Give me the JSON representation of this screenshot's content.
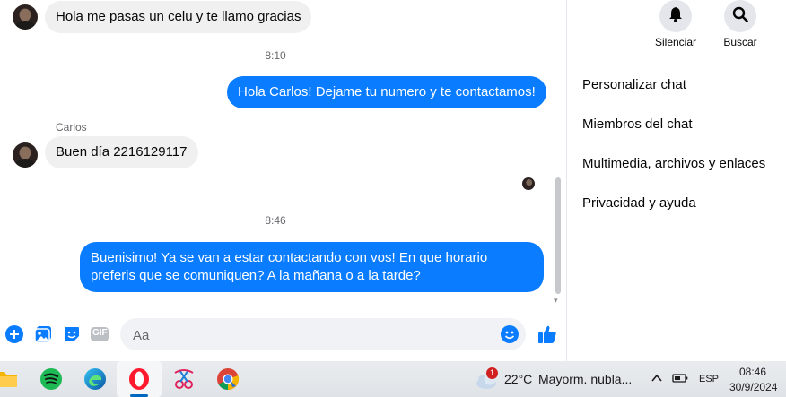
{
  "messages": {
    "in_1": "Hola me pasas un celu y te llamo gracias",
    "time_1": "8:10",
    "out_1": "Hola Carlos! Dejame tu numero y te contactamos!",
    "sender_name": "Carlos",
    "in_2": "Buen día 2216129117",
    "time_2": "8:46",
    "out_2": "Buenisimo! Ya se van a estar contactando con vos! En que horario preferis que se comuniquen? A la mañana o a la tarde?"
  },
  "composer": {
    "placeholder": "Aa",
    "icons": [
      "plus-icon",
      "image-icon",
      "sticker-icon",
      "gif-icon",
      "emoji-icon",
      "like-icon"
    ],
    "gif_label": "GIF"
  },
  "panel": {
    "mute_label": "Silenciar",
    "search_label": "Buscar",
    "menu": [
      "Personalizar chat",
      "Miembros del chat",
      "Multimedia, archivos y enlaces",
      "Privacidad y ayuda"
    ]
  },
  "taskbar": {
    "weather_badge": "1",
    "temperature": "22°C",
    "weather_text": "Mayorm. nubla...",
    "language": "ESP",
    "time": "08:46",
    "date": "30/9/2024",
    "apps": [
      "file-explorer-icon",
      "spotify-icon",
      "edge-icon",
      "opera-icon",
      "snipping-tool-icon",
      "chrome-icon"
    ]
  },
  "colors": {
    "accent": "#0a7cff",
    "incoming_bubble": "#f0f0f0",
    "icon_blue": "#0a7cff"
  }
}
